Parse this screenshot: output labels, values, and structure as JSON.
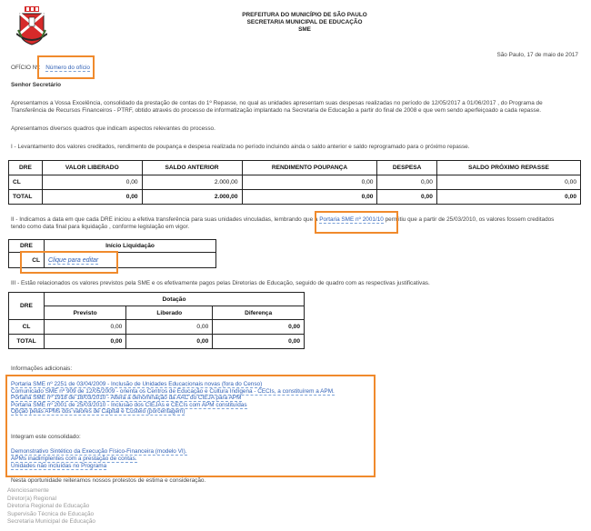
{
  "header": {
    "line1": "PREFEITURA DO MUNICÍPIO DE SÃO PAULO",
    "line2": "SECRETARIA MUNICIPAL DE EDUCAÇÃO",
    "line3": "SME",
    "date": "São Paulo, 17 de maio de 2017"
  },
  "oficio": {
    "label": "OFÍCIO Nº:",
    "link": "Número do ofício"
  },
  "salutation": "Senhor Secretário",
  "intro": "Apresentamos a Vossa Excelência, consolidado da prestação de contas do 1º Repasse, no qual as unidades apresentam suas despesas realizadas no período de 12/05/2017 a 01/06/2017 , do Programa de Transferência de Recursos Financeiros - PTRF, obtido através do processo de informatização implantado na Secretaria de Educação a partir do final de 2008 e que vem sendo aperfeiçoado a cada repasse.",
  "intro2": "Apresentamos diversos quadros que indicam aspectos relevantes do processo.",
  "section1": "I - Levantamento dos valores creditados, rendimento de poupança e despesa realizada no período incluindo ainda o saldo anterior e saldo reprogramado para o próximo repasse.",
  "table1": {
    "headers": [
      "DRE",
      "VALOR LIBERADO",
      "SALDO ANTERIOR",
      "RENDIMENTO POUPANÇA",
      "DESPESA",
      "SALDO PRÓXIMO REPASSE"
    ],
    "rows": [
      [
        "CL",
        "0,00",
        "2.000,00",
        "0,00",
        "0,00",
        "0,00"
      ],
      [
        "TOTAL",
        "0,00",
        "2.000,00",
        "0,00",
        "0,00",
        "0,00"
      ]
    ]
  },
  "section2": {
    "before": "II - Indicamos a data em que cada DRE iniciou a efetiva transferência para suas unidades vinculadas, lembrando que a",
    "link": "Portaria SME nº 2001/10",
    "after": "permitiu que a partir de 25/03/2010, os valores fossem creditados tendo como data final para liquidação , conforme legislação em vigor."
  },
  "table2": {
    "headers": [
      "DRE",
      "Início Liquidação"
    ],
    "row": {
      "dre": "CL",
      "link": "Clique para editar"
    }
  },
  "section3": "III - Estão relacionados os valores previstos pela SME e os efetivamente pagos pelas Diretorias de Educação, seguido de quadro com as respectivas justificativas.",
  "table3": {
    "dre": "DRE",
    "group": "Dotação",
    "headers": [
      "Previsto",
      "Liberado",
      "Diferença"
    ],
    "rows": [
      [
        "CL",
        "0,00",
        "0,00",
        "0,00"
      ],
      [
        "TOTAL",
        "0,00",
        "0,00",
        "0,00"
      ]
    ]
  },
  "info": {
    "title": "Informações adicionais:",
    "links": [
      "Portaria SME nº 2251 de 03/04/2009 - Inclusão de Unidades Educacionais novas (fora do Censo)",
      "Comunicado SME nº 909 de 12/05/2009 - orienta os Centros de Educação e Cultura Indígena - CECIs, a constituírem a APM.",
      "Portaria SME nº 1918 de 18/03/2010 - Altera a denominação da AAC do CIEJA para APM",
      "Portaria SME nº 2001 de 25/03/2010 - Inclusão dos CIEJAs e CECIs com APM constituídas",
      "Opção pelas APMs dos valores de Capital e Custeio (porcentagem)"
    ],
    "integram": "Integram este consolidado:",
    "integram_links": [
      "Demonstrativo Sintético da Execução Físico-Financeira (modelo VI).",
      "APMs inadimplentes com a prestação de contas.",
      "Unidades não incluídas no Programa"
    ]
  },
  "closing": "Nesta oportunidade reiteramos nossos protestos de estima e consideração.",
  "signature": [
    "Atenciosamente",
    "Diretor(a) Regional",
    "Diretoria Regional de Educação",
    "Supervisão Técnica de Educação",
    "Secretaria Municipal de Educação"
  ],
  "colors": {
    "link": "#2e5fb5",
    "highlight": "#f08a2c"
  }
}
